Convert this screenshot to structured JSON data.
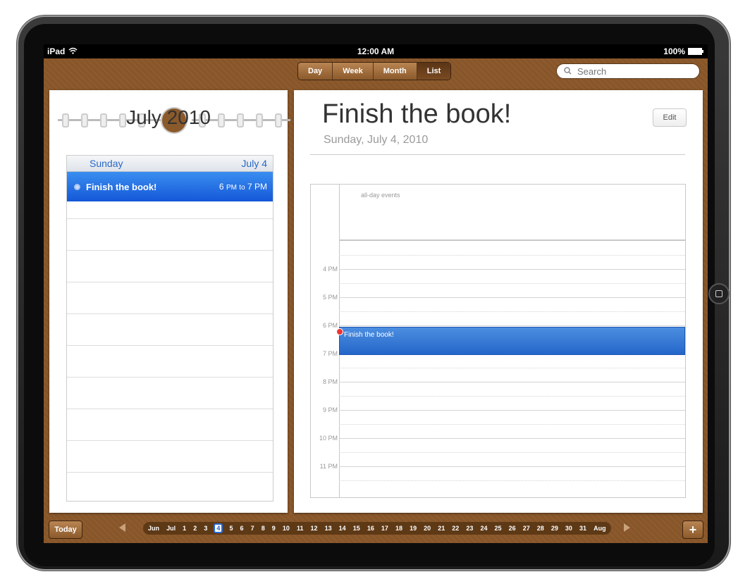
{
  "status_bar": {
    "device": "iPad",
    "time": "12:00 AM",
    "battery": "100%"
  },
  "view_switcher": {
    "items": [
      "Day",
      "Week",
      "Month",
      "List"
    ],
    "selected": "List"
  },
  "search": {
    "placeholder": "Search"
  },
  "left_page": {
    "title": "July 2010",
    "day_header": {
      "weekday": "Sunday",
      "date": "July 4"
    },
    "events": [
      {
        "title": "Finish the book!",
        "start": "6",
        "start_suffix": "PM",
        "to": "to",
        "end": "7 PM"
      }
    ]
  },
  "right_page": {
    "title": "Finish the book!",
    "date": "Sunday, July 4, 2010",
    "edit_label": "Edit",
    "all_day_label": "all-day events",
    "hours": [
      "4 PM",
      "5 PM",
      "6 PM",
      "7 PM",
      "8 PM",
      "9 PM",
      "10 PM",
      "11 PM"
    ],
    "event_title": "Finish the book!"
  },
  "bottom_bar": {
    "today_label": "Today",
    "timeline": [
      "Jun",
      "Jul",
      "1",
      "2",
      "3",
      "4",
      "5",
      "6",
      "7",
      "8",
      "9",
      "10",
      "11",
      "12",
      "13",
      "14",
      "15",
      "16",
      "17",
      "18",
      "19",
      "20",
      "21",
      "22",
      "23",
      "24",
      "25",
      "26",
      "27",
      "28",
      "29",
      "30",
      "31",
      "Aug"
    ],
    "selected_day": "4",
    "add_label": "+"
  }
}
